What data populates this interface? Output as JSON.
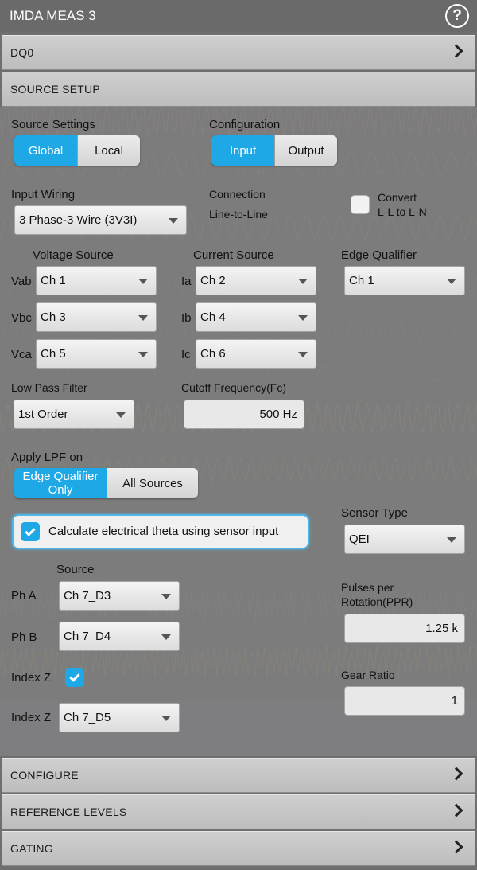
{
  "window": {
    "title": "IMDA MEAS 3",
    "help_icon": "help-circle-icon"
  },
  "sections": {
    "dq0": "DQ0",
    "source_setup": "SOURCE SETUP",
    "configure": "CONFIGURE",
    "reference_levels": "REFERENCE LEVELS",
    "gating": "GATING"
  },
  "source_settings": {
    "label": "Source Settings",
    "options": [
      "Global",
      "Local"
    ],
    "selected": "Global"
  },
  "configuration": {
    "label": "Configuration",
    "options": [
      "Input",
      "Output"
    ],
    "selected": "Input"
  },
  "input_wiring": {
    "label": "Input Wiring",
    "value": "3 Phase-3 Wire (3V3I)"
  },
  "connection": {
    "label": "Connection",
    "value": "Line-to-Line"
  },
  "convert": {
    "label_line1": "Convert",
    "label_line2": "L-L to L-N",
    "checked": false
  },
  "voltage_source": {
    "label": "Voltage Source",
    "rows": [
      {
        "name": "Vab",
        "value": "Ch 1"
      },
      {
        "name": "Vbc",
        "value": "Ch 3"
      },
      {
        "name": "Vca",
        "value": "Ch 5"
      }
    ]
  },
  "current_source": {
    "label": "Current Source",
    "rows": [
      {
        "name": "Ia",
        "value": "Ch 2"
      },
      {
        "name": "Ib",
        "value": "Ch 4"
      },
      {
        "name": "Ic",
        "value": "Ch 6"
      }
    ]
  },
  "edge_qualifier": {
    "label": "Edge Qualifier",
    "value": "Ch 1"
  },
  "low_pass_filter": {
    "label": "Low Pass Filter",
    "value": "1st Order"
  },
  "cutoff_frequency": {
    "label": "Cutoff Frequency(Fc)",
    "value": "500 Hz"
  },
  "apply_lpf": {
    "label": "Apply LPF on",
    "option1_line1": "Edge Qualifier",
    "option1_line2": "Only",
    "option2": "All Sources",
    "selected": "Edge Qualifier Only"
  },
  "theta": {
    "label": "Calculate electrical theta using sensor input",
    "checked": true
  },
  "sensor_type": {
    "label": "Sensor Type",
    "value": "QEI"
  },
  "sensor_source": {
    "label": "Source",
    "ph_a": {
      "name": "Ph A",
      "value": "Ch 7_D3"
    },
    "ph_b": {
      "name": "Ph B",
      "value": "Ch 7_D4"
    },
    "index_z_check": {
      "name": "Index Z",
      "checked": true
    },
    "index_z": {
      "name": "Index Z",
      "value": "Ch 7_D5"
    }
  },
  "ppr": {
    "label_line1": "Pulses per",
    "label_line2": "Rotation(PPR)",
    "value": "1.25 k"
  },
  "gear_ratio": {
    "label": "Gear Ratio",
    "value": "1"
  },
  "colors": {
    "accent": "#1ea8e6",
    "header_bg": "#6a6a6a",
    "section_bg": "#c8c8c8"
  }
}
